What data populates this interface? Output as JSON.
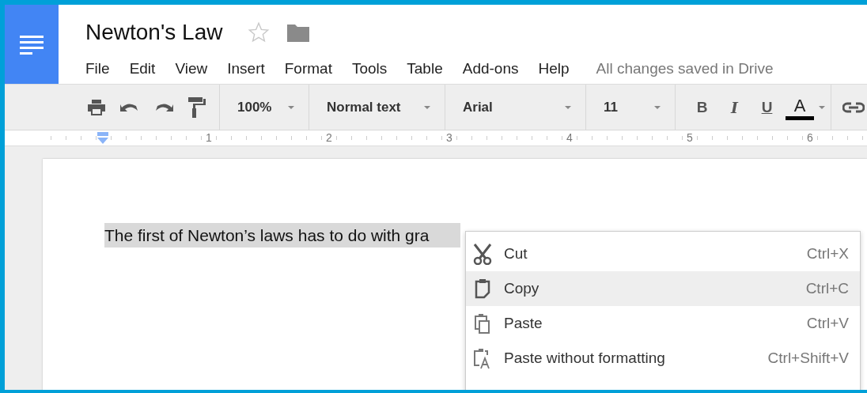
{
  "document_title": "Newton's Law",
  "starred": false,
  "menu_bar": [
    "File",
    "Edit",
    "View",
    "Insert",
    "Format",
    "Tools",
    "Table",
    "Add-ons",
    "Help"
  ],
  "save_status": "All changes saved in Drive",
  "toolbar": {
    "zoom": "100%",
    "style": "Normal text",
    "font": "Arial",
    "font_size": "11",
    "bold": "B",
    "italic": "I",
    "underline": "U",
    "text_color": "A"
  },
  "ruler": [
    "1",
    "2",
    "3",
    "4",
    "5",
    "6"
  ],
  "document": {
    "text": "The first of Newton’s laws has to do with gra",
    "selected": true
  },
  "context_menu": [
    {
      "kind": "cut",
      "label": "Cut",
      "shortcut": "Ctrl+X",
      "selected": false
    },
    {
      "kind": "copy",
      "label": "Copy",
      "shortcut": "Ctrl+C",
      "selected": true
    },
    {
      "kind": "paste",
      "label": "Paste",
      "shortcut": "Ctrl+V",
      "selected": false
    },
    {
      "kind": "paste_plain",
      "label": "Paste without formatting",
      "shortcut": "Ctrl+Shift+V",
      "selected": false
    }
  ]
}
